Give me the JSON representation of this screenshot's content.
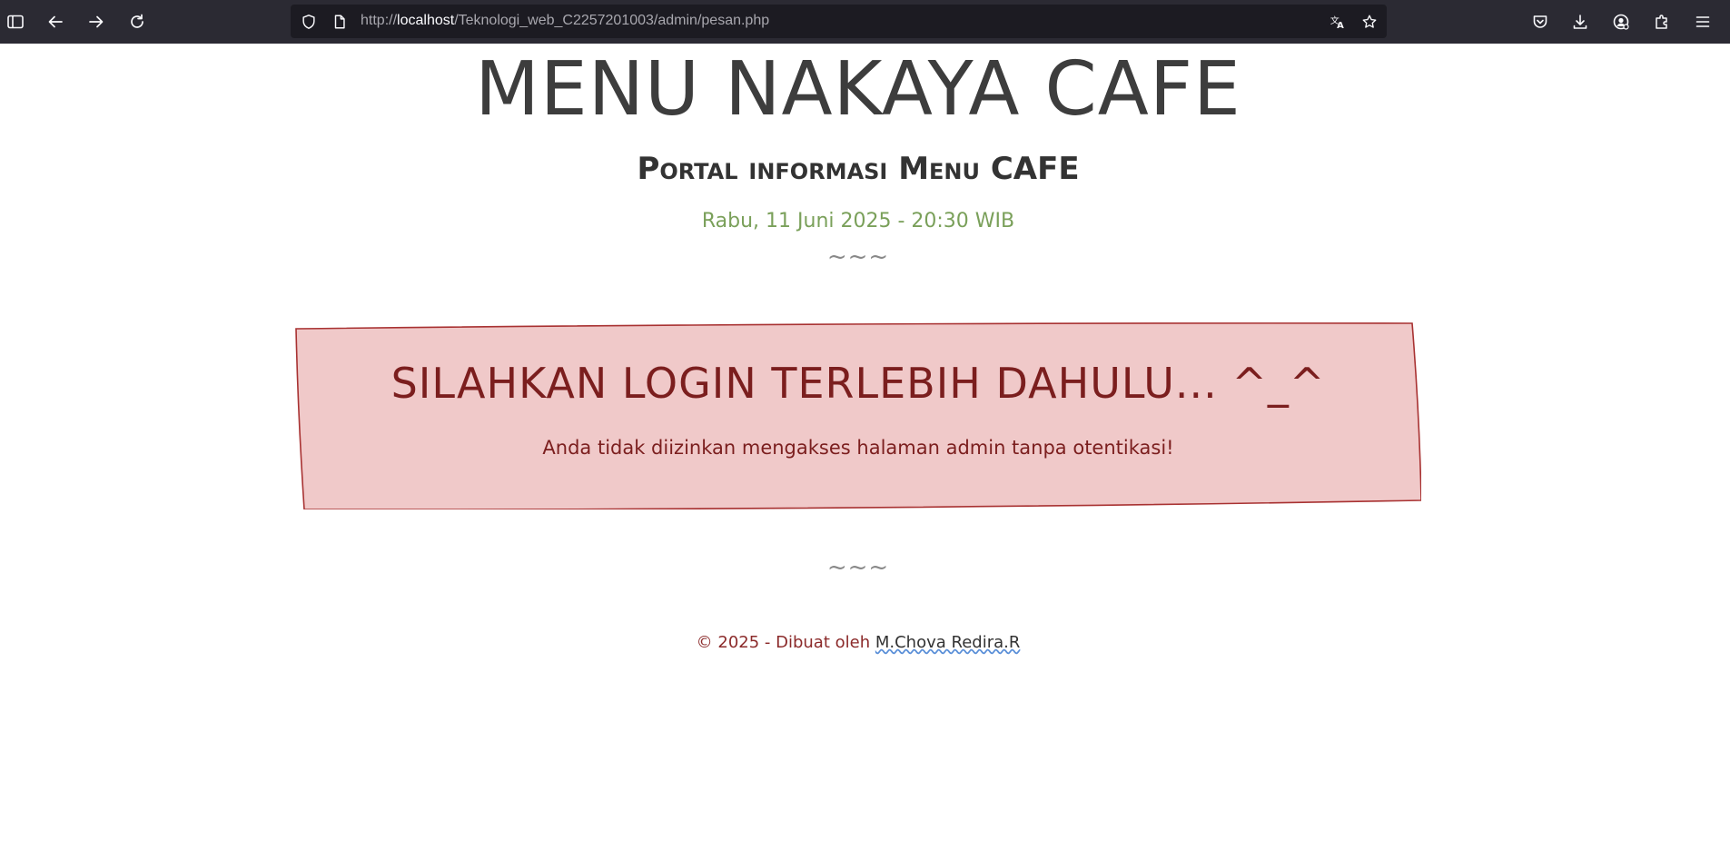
{
  "browser": {
    "url_prefix": "http://",
    "url_host": "localhost",
    "url_path": "/Teknologi_web_C2257201003/admin/pesan.php",
    "icons": {
      "sidebar": "sidebar-icon",
      "back": "back-arrow-icon",
      "forward": "forward-arrow-icon",
      "reload": "reload-icon",
      "shield": "shield-icon",
      "page": "page-icon",
      "translate": "translate-icon",
      "bookmark": "star-icon",
      "pocket": "pocket-icon",
      "downloads": "download-icon",
      "account": "account-icon",
      "extensions": "extensions-icon",
      "menu": "hamburger-menu-icon"
    }
  },
  "header": {
    "title": "MENU NAKAYA CAFE",
    "subtitle": "Portal informasi Menu CAFE",
    "datetime": "Rabu, 11 Juni 2025 - 20:30 WIB",
    "divider": "~~~"
  },
  "alert": {
    "heading": "SILAHKAN LOGIN TERLEBIH DAHULU... ^_^",
    "message": "Anda tidak diizinkan mengakses halaman admin tanpa otentikasi!"
  },
  "footer": {
    "divider": "~~~",
    "copyright": "© 2025 - Dibuat oleh ",
    "author": "M.Chova Redira.R"
  },
  "colors": {
    "chrome_bg": "#2b2a33",
    "urlbar_bg": "#1c1b22",
    "alert_bg": "#f0c9c9",
    "alert_border": "#a83232",
    "alert_text": "#7b1e1e",
    "datetime": "#7aa05a"
  }
}
